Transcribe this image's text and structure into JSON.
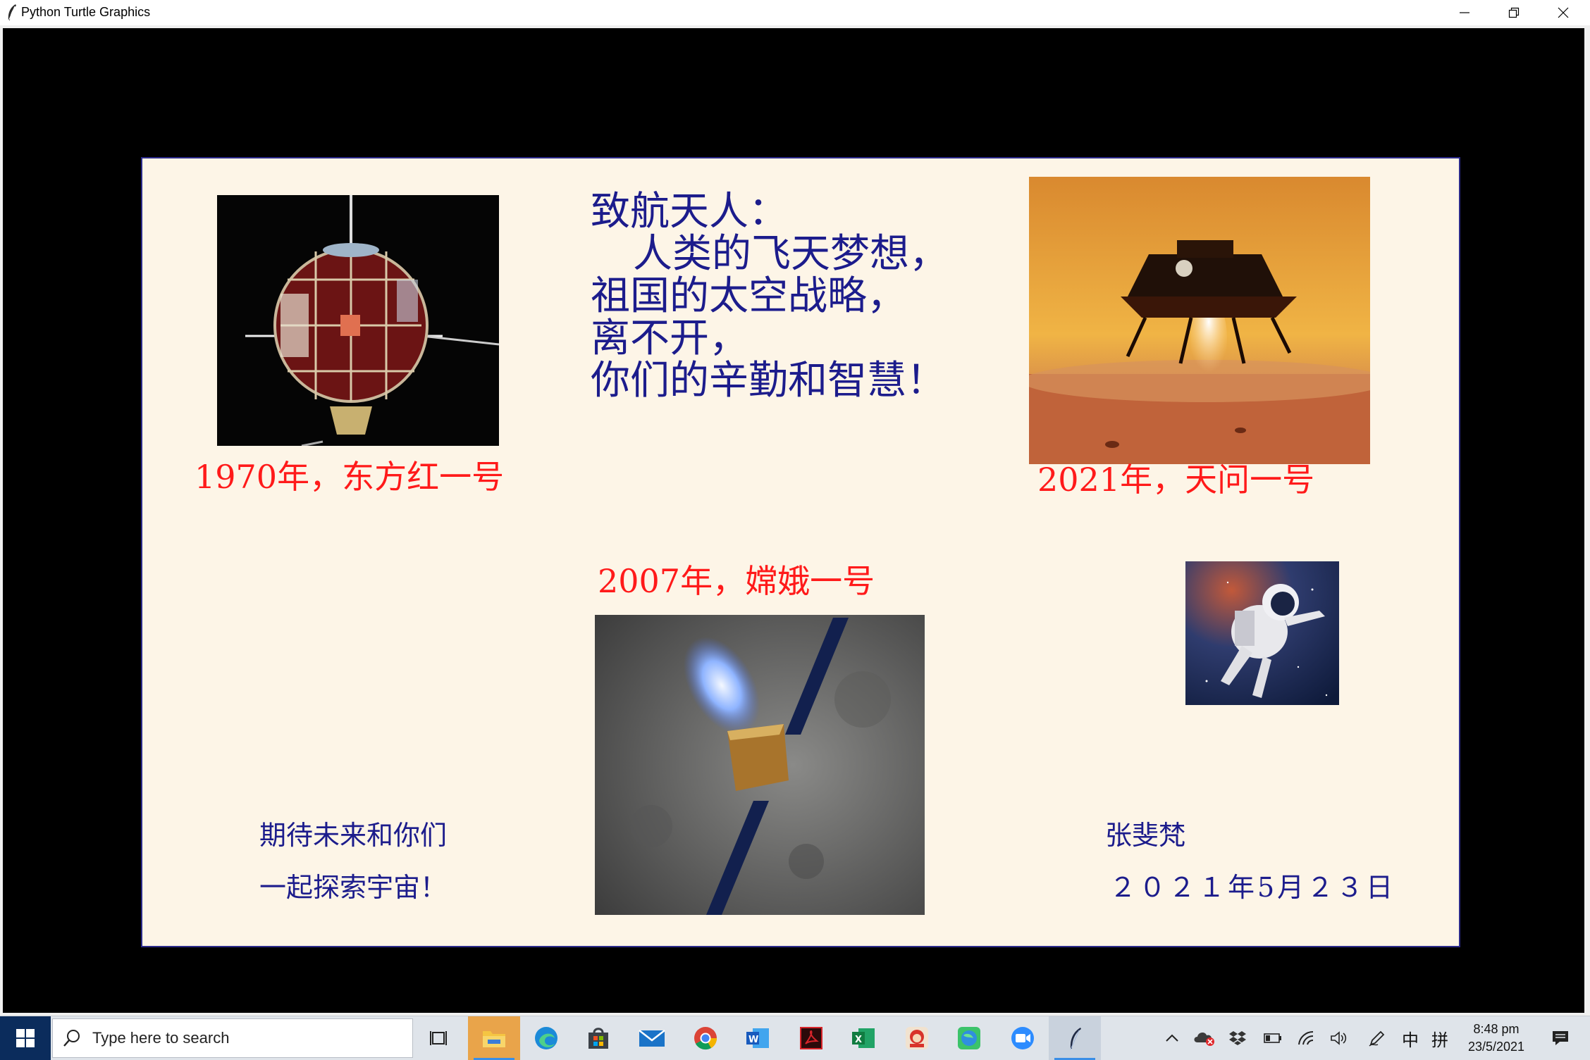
{
  "window": {
    "title": "Python Turtle Graphics",
    "icons": [
      "feather-icon",
      "minimize-icon",
      "restore-icon",
      "close-icon"
    ]
  },
  "card": {
    "background": "#fdf5e7",
    "captions": {
      "dongfanghong": "1970年，东方红一号",
      "tianwen": "2021年，天问一号",
      "change": "2007年，嫦娥一号"
    },
    "poem": [
      "致航天人：",
      "   人类的飞天梦想，",
      "祖国的太空战略，",
      "离不开，",
      "你们的辛勤和智慧！"
    ],
    "closing": [
      "期待未来和你们",
      "一起探索宇宙！"
    ],
    "author": "张斐梵",
    "date": "２０２１年5月２３日",
    "colors": {
      "caption": "#ff1a1a",
      "text": "#1c1c8c"
    }
  },
  "taskbar": {
    "search_placeholder": "Type here to search",
    "apps": [
      "task-view-icon",
      "file-explorer-icon",
      "edge-icon",
      "store-icon",
      "mail-icon",
      "chrome-icon",
      "word-icon",
      "acrobat-icon",
      "excel-icon",
      "game-icon",
      "maps-icon",
      "zoom-icon",
      "python-turtle-icon"
    ],
    "tray": {
      "ime_lang": "中",
      "ime_mode": "拼",
      "time": "8:48 pm",
      "date": "23/5/2021"
    }
  }
}
